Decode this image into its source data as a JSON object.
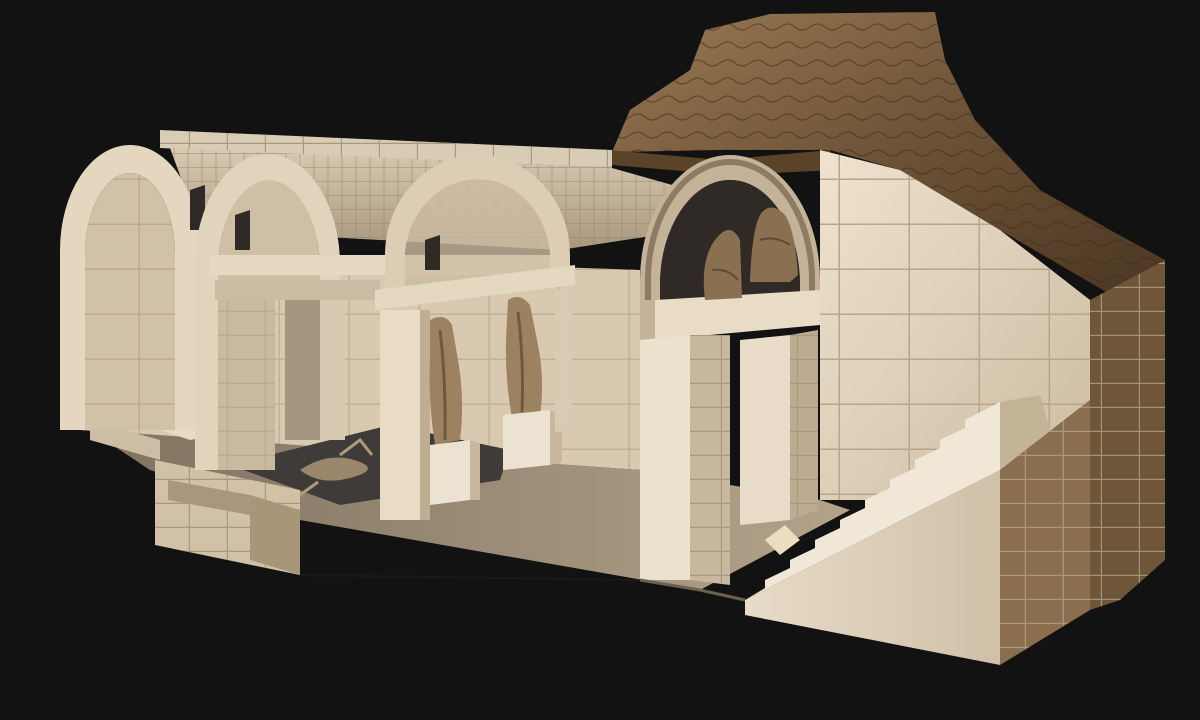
{
  "scene": {
    "subject": "3d-cutaway-tomb-model",
    "colors": {
      "background": "#121212",
      "limestone_light": "#e7d9c3",
      "limestone_mid": "#cdbda4",
      "limestone_shadow": "#9f8f78",
      "limestone_dark": "#7e705d",
      "earth_light": "#8d6e4c",
      "earth_dark": "#4e3a25",
      "floor_stone": "#9c8c78",
      "mosaic_dark": "#3f3b38",
      "mosaic_motif": "#b09a78",
      "statue": "#9c8260",
      "statue_dark": "#6f5a40",
      "sphinx": "#8a7050"
    }
  }
}
